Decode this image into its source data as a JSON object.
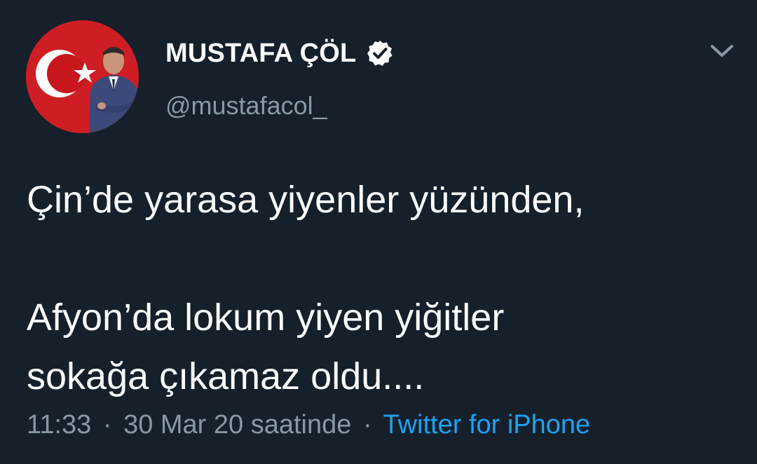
{
  "user": {
    "display_name": "MUSTAFA ÇÖL",
    "handle": "@mustafacol_",
    "verified": true,
    "avatar_icon": "profile-photo-turkish-flag"
  },
  "tweet": {
    "line1": "Çin’de yarasa yiyenler yüzünden,",
    "line2": "",
    "line3": "Afyon’da lokum yiyen yiğitler",
    "line4": "sokağa çıkamaz oldu...."
  },
  "meta": {
    "time": "11:33",
    "separator": "·",
    "date": "30 Mar 20 saatinde",
    "source": "Twitter for iPhone"
  },
  "colors": {
    "background": "#15202b",
    "primary_text": "#ffffff",
    "secondary_text": "#8899a6",
    "accent": "#1da1f2"
  },
  "icons": {
    "verified": "verified-badge-icon",
    "menu": "chevron-down-icon"
  }
}
